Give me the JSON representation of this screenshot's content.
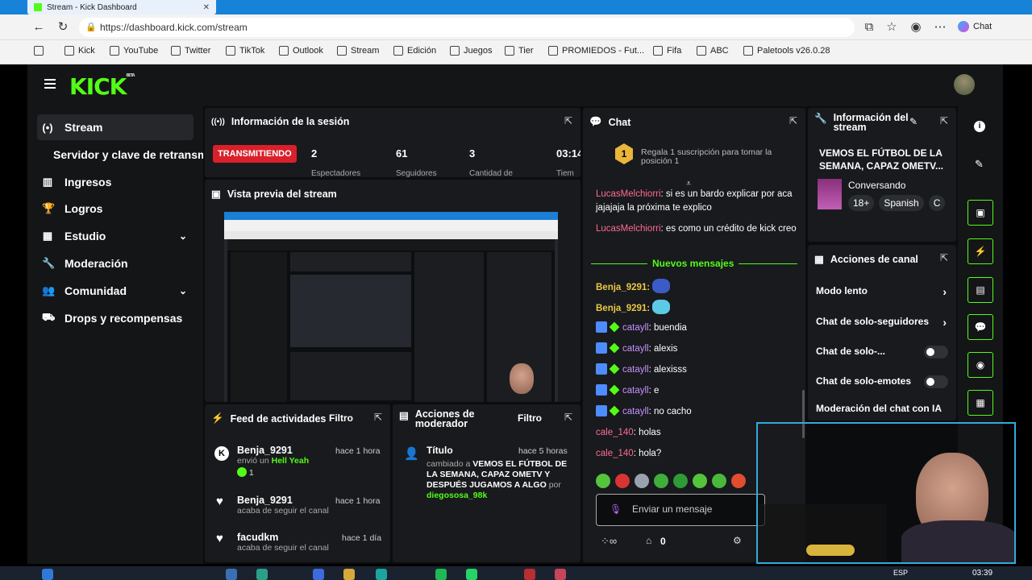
{
  "browser": {
    "tab_title": "Stream - Kick Dashboard",
    "url": "https://dashboard.kick.com/stream",
    "chat_label": "Chat",
    "bookmarks": [
      "Kick",
      "YouTube",
      "Twitter",
      "TikTok",
      "Outlook",
      "Stream",
      "Edición",
      "Juegos",
      "Tier",
      "PROMIEDOS - Fut...",
      "Fifa",
      "ABC",
      "Paletools v26.0.28"
    ]
  },
  "header": {
    "logo": "KICK",
    "logo_sup": "BETA"
  },
  "sidebar": {
    "items": [
      {
        "label": "Stream",
        "icon": "broadcast-icon"
      },
      {
        "label": "Servidor y clave de retransm",
        "icon": ""
      },
      {
        "label": "Ingresos",
        "icon": "chart-icon"
      },
      {
        "label": "Logros",
        "icon": "trophy-icon"
      },
      {
        "label": "Estudio",
        "icon": "grid-icon"
      },
      {
        "label": "Moderación",
        "icon": "wrench-icon"
      },
      {
        "label": "Comunidad",
        "icon": "people-icon"
      },
      {
        "label": "Drops y recompensas",
        "icon": "gift-icon"
      }
    ]
  },
  "session": {
    "title": "Información de la sesión",
    "live_badge": "TRANSMITIENDO",
    "stats": [
      {
        "value": "2",
        "label": "Espectadores"
      },
      {
        "value": "61",
        "label": "Seguidores"
      },
      {
        "value": "3",
        "label": "Cantidad de"
      },
      {
        "value": "03:14",
        "label": "Tiem"
      }
    ]
  },
  "preview": {
    "title": "Vista previa del stream"
  },
  "activity": {
    "title": "Feed de actividades",
    "filter": "Filtro",
    "items": [
      {
        "user": "Benja_9291",
        "time": "hace 1 hora",
        "text": "envió un",
        "highlight": "Hell Yeah",
        "count": "1"
      },
      {
        "user": "Benja_9291",
        "time": "hace 1 hora",
        "text": "acaba de seguir el canal"
      },
      {
        "user": "facudkm",
        "time": "hace 1 día",
        "text": "acaba de seguir el canal"
      }
    ]
  },
  "mod_actions": {
    "title": "Acciones de moderador",
    "filter": "Filtro",
    "item_title": "Título",
    "time": "hace 5 horas",
    "prefix": "cambiado a",
    "bold": "VEMOS EL FÚTBOL DE LA SEMANA, CAPAZ OMETV Y DESPUÉS JUGAMOS A ALGO",
    "by": "por",
    "user": "diegososa_98k"
  },
  "chat": {
    "title": "Chat",
    "gift_rank": "1",
    "gift_text": "Regala 1 suscripción para tomar la posición 1",
    "new_messages": "Nuevos mensajes",
    "messages": [
      {
        "user": "LucasMelchiorri",
        "text": ": si es un bardo explicar por aca jajajaja la próxima te explico"
      },
      {
        "user": "LucasMelchiorri",
        "text": ": es como un crédito de kick creo"
      },
      {
        "user": "Benja_9291:",
        "text": ""
      },
      {
        "user": "Benja_9291:",
        "text": ""
      },
      {
        "user": "catayll",
        "text": ": buendia"
      },
      {
        "user": "catayll",
        "text": ": alexis"
      },
      {
        "user": "catayll",
        "text": ": alexisss"
      },
      {
        "user": "catayll",
        "text": ": e"
      },
      {
        "user": "catayll",
        "text": ": no cacho"
      },
      {
        "user": "cale_140",
        "text": ": holas"
      },
      {
        "user": "cale_140",
        "text": ": hola?"
      }
    ],
    "placeholder": "Enviar un mensaje",
    "points": "0"
  },
  "stream_info": {
    "title": "Información del stream",
    "stream_title": "VEMOS EL FÚTBOL DE LA SEMANA, CAPAZ OMETV...",
    "category": "Conversando",
    "tags": [
      "18+",
      "Spanish",
      "C"
    ]
  },
  "channel_actions": {
    "title": "Acciones de canal",
    "items": [
      {
        "label": "Modo lento",
        "control": "chevron"
      },
      {
        "label": "Chat de solo-seguidores",
        "control": "chevron"
      },
      {
        "label": "Chat de solo-...",
        "control": "toggle"
      },
      {
        "label": "Chat de solo-emotes",
        "control": "toggle"
      },
      {
        "label": "Moderación del chat con IA",
        "control": "link"
      }
    ]
  },
  "taskbar": {
    "lang": "ESP",
    "time": "03:39"
  },
  "colors": {
    "accent": "#53fc18",
    "live": "#d9202b",
    "bg": "#0b0c0d",
    "panel": "#181a1d"
  }
}
